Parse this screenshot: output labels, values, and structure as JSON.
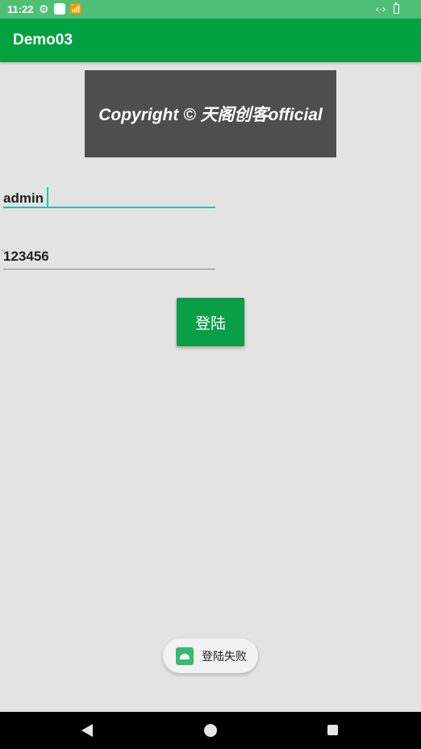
{
  "status_bar": {
    "time": "11:22",
    "icons": [
      "settings-icon",
      "notification-square-icon",
      "signal-icon",
      "code-icon",
      "battery-icon"
    ]
  },
  "app_bar": {
    "title": "Demo03"
  },
  "banner": {
    "text": "Copyright © 天阁创客official"
  },
  "form": {
    "username_value": "admin",
    "password_value": "123456",
    "login_label": "登陆"
  },
  "toast": {
    "message": "登陆失败",
    "icon": "android-app-icon"
  },
  "nav_bar": {
    "buttons": [
      "back-icon",
      "home-icon",
      "recents-icon"
    ]
  },
  "colors": {
    "status_bar": "#4fbf75",
    "app_bar": "#02a140",
    "button": "#0a9e46",
    "background": "#e3e3e1",
    "banner": "#4e4f4b",
    "input_focus": "#1fc7ad"
  }
}
